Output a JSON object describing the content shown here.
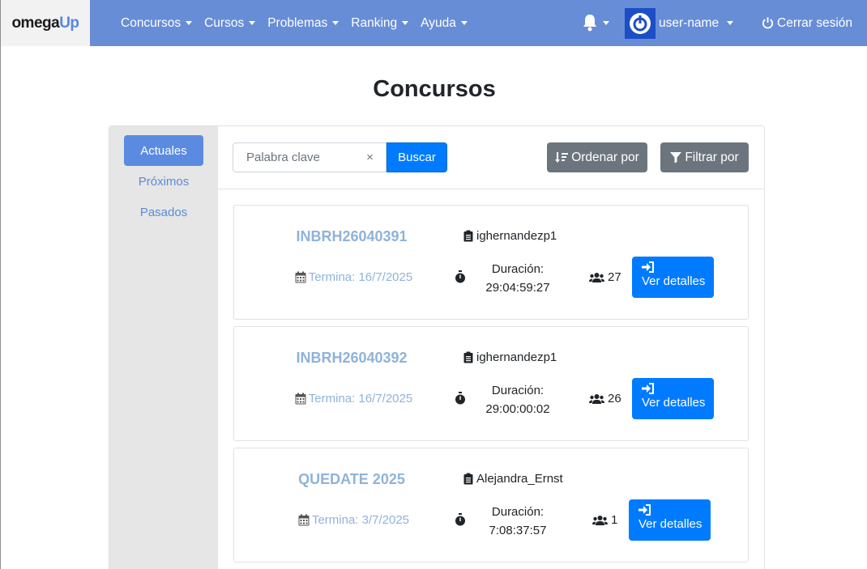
{
  "brand": {
    "part1": "omega",
    "part2": "Up"
  },
  "nav": {
    "items": [
      "Concursos",
      "Cursos",
      "Problemas",
      "Ranking",
      "Ayuda"
    ],
    "user_name": "user-name",
    "logout": "Cerrar sesión"
  },
  "page": {
    "title": "Concursos"
  },
  "sidebar": {
    "tabs": [
      "Actuales",
      "Próximos",
      "Pasados"
    ],
    "active": "Actuales"
  },
  "toolbar": {
    "search_placeholder": "Palabra clave",
    "clear": "×",
    "search_button": "Buscar",
    "sort_button": "Ordenar por",
    "filter_button": "Filtrar por"
  },
  "contests": [
    {
      "title": "INBRH26040391",
      "owner": "ighernandezp1",
      "ends": "Termina: 16/7/2025",
      "duration_label": "Duración:",
      "duration": "29:04:59:27",
      "participants": "27",
      "details": "Ver detalles"
    },
    {
      "title": "INBRH26040392",
      "owner": "ighernandezp1",
      "ends": "Termina: 16/7/2025",
      "duration_label": "Duración:",
      "duration": "29:00:00:02",
      "participants": "26",
      "details": "Ver detalles"
    },
    {
      "title": "QUEDATE 2025",
      "owner": "Alejandra_Ernst",
      "ends": "Termina: 3/7/2025",
      "duration_label": "Duración:",
      "duration": "7:08:37:57",
      "participants": "1",
      "details": "Ver detalles"
    }
  ],
  "colors": {
    "navbar": "#678dd7",
    "primary": "#007bff",
    "secondary": "#6c757d",
    "link_muted": "#8fb3d9",
    "sidebar": "#e6e6e6"
  }
}
